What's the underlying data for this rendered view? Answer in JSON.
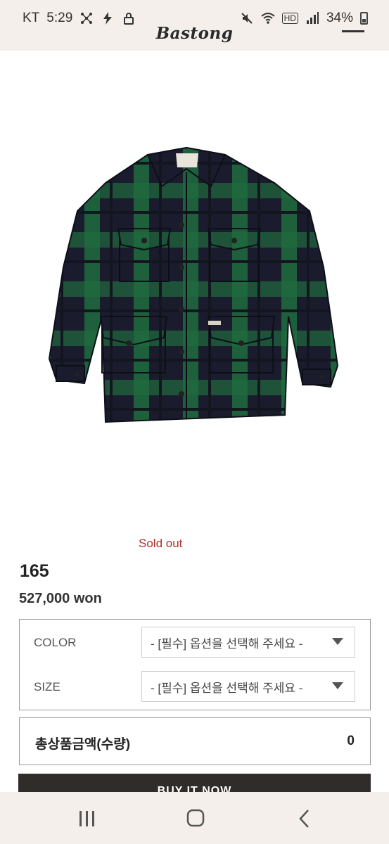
{
  "status_bar": {
    "carrier": "KT",
    "time": "5:29",
    "battery": "34%",
    "network": "HD"
  },
  "header": {
    "brand": "Bastong"
  },
  "product": {
    "status": "Sold out",
    "name": "165",
    "price": "527,000 won"
  },
  "options": [
    {
      "label": "COLOR",
      "selected": "- [필수] 옵션을 선택해 주세요 -"
    },
    {
      "label": "SIZE",
      "selected": "- [필수] 옵션을 선택해 주세요 -"
    }
  ],
  "total": {
    "label": "총상품금액(수량)",
    "value": "0"
  },
  "buy_button": {
    "label": "BUY IT NOW"
  },
  "colors": {
    "status_bg": "#f4efea",
    "sold_out": "#b0302a",
    "button_bg": "#2f2c2a",
    "jacket_green": "#1f6b3e",
    "jacket_navy": "#1a1c2e"
  },
  "icons": {
    "status_left": [
      "network-icon",
      "flash-icon",
      "lock-icon"
    ],
    "status_right": [
      "mute-icon",
      "wifi-icon",
      "signal-icon",
      "battery-icon"
    ],
    "nav": [
      "recent-apps-icon",
      "home-icon",
      "back-icon"
    ]
  }
}
